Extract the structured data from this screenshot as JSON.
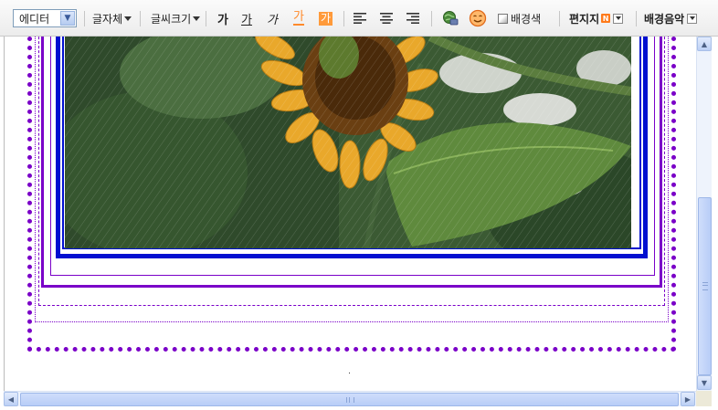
{
  "toolbar": {
    "mode_select": "에디터",
    "font_face": "글자체",
    "font_size": "글씨크기",
    "bold": "가",
    "underline": "가",
    "italic": "가",
    "font_color": "가",
    "highlight": "가",
    "bg_color": "배경색",
    "stationery": "편지지",
    "stationery_badge": "N",
    "bg_music": "배경음악"
  },
  "colors": {
    "purple": "#7a00c8",
    "blue": "#0010d0",
    "toolbar_bg": "#ececec"
  }
}
